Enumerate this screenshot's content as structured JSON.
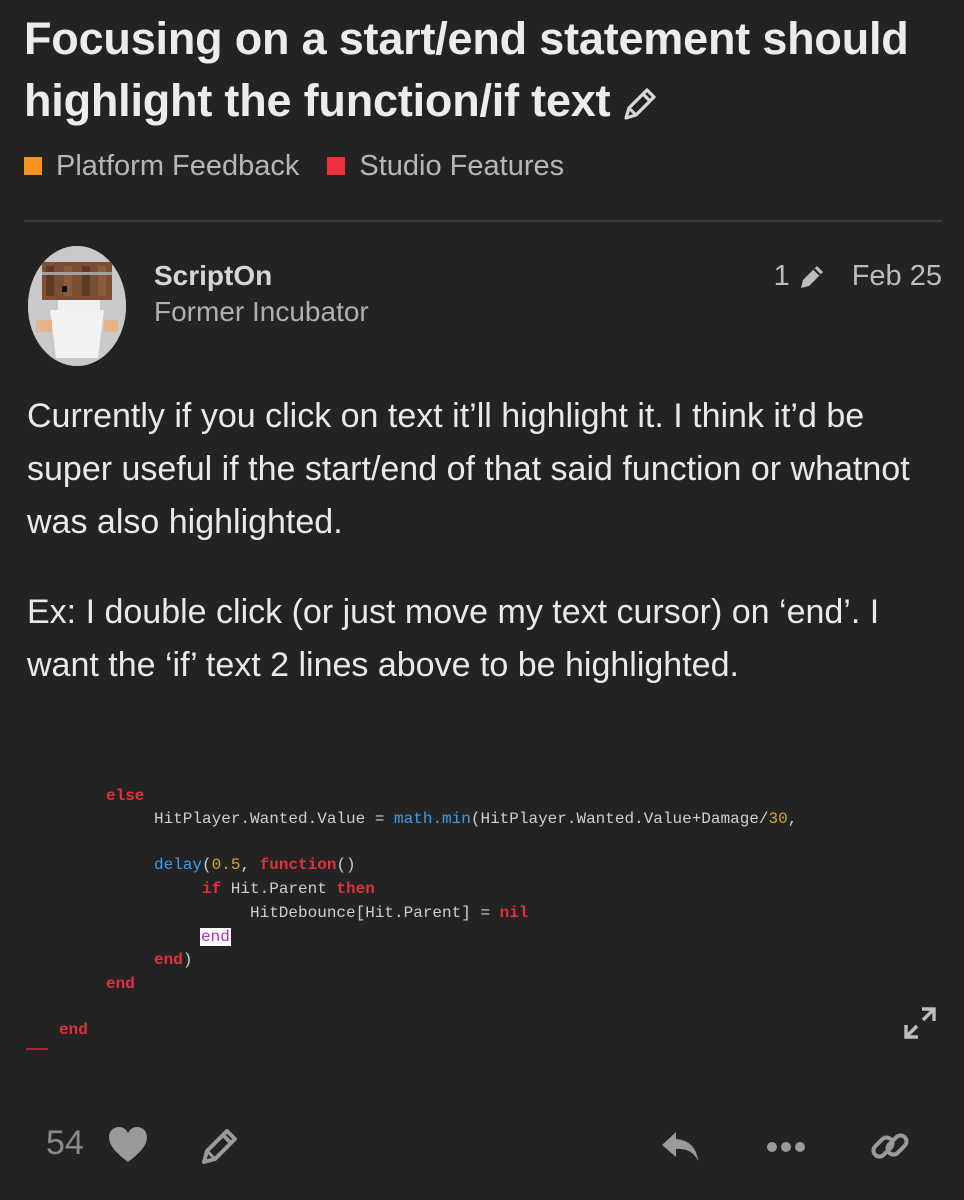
{
  "topic": {
    "title": "Focusing on a start/end statement should highlight the function/if text",
    "categories": [
      {
        "label": "Platform Feedback",
        "color": "#f7941d"
      },
      {
        "label": "Studio Features",
        "color": "#ed2f3f"
      }
    ]
  },
  "post": {
    "username": "ScriptOn",
    "user_title": "Former Incubator",
    "edit_count": "1",
    "date": "Feb 25",
    "paragraphs": [
      "Currently if you click on text it’ll highlight it. I think it’d be super useful if the start/end of that said function or whatnot was also highlighted.",
      "Ex: I double click (or just move my text cursor) on ‘end’. I want the ‘if’ text 2 lines above to be highlighted."
    ],
    "code": {
      "line1": "else",
      "line2_a": "HitPlayer.Wanted.Value = ",
      "line2_b": "math.min",
      "line2_c": "(HitPlayer.Wanted.Value+Damage/",
      "line2_d": "30",
      "line2_e": ",",
      "line3_a": "delay",
      "line3_b": "(",
      "line3_c": "0.5",
      "line3_d": ", ",
      "line3_e": "function",
      "line3_f": "()",
      "line4_a": "if",
      "line4_b": " Hit.Parent ",
      "line4_c": "then",
      "line5_a": "HitDebounce[Hit.Parent] = ",
      "line5_b": "nil",
      "line6": "end",
      "line7_a": "end",
      "line7_b": ")",
      "line8": "end",
      "line9": "end"
    }
  },
  "actions": {
    "like_count": "54"
  },
  "icons": {
    "edit_title": "pencil-icon",
    "like": "heart-icon",
    "edit": "pencil-icon",
    "reply": "reply-icon",
    "more": "ellipsis-icon",
    "share": "link-icon",
    "expand": "expand-icon"
  }
}
